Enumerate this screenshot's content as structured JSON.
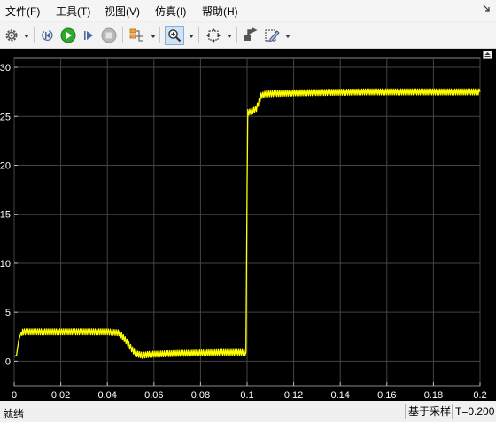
{
  "menu": [
    {
      "label": "文件(F)"
    },
    {
      "label": "工具(T)"
    },
    {
      "label": "视图(V)"
    },
    {
      "label": "仿真(I)"
    },
    {
      "label": "帮助(H)"
    }
  ],
  "toolbar": [
    {
      "icon": "gear-icon",
      "dropdown": true
    },
    {
      "icon": "step-back-icon"
    },
    {
      "icon": "run-icon",
      "color": "#2fa82f"
    },
    {
      "icon": "step-forward-icon"
    },
    {
      "icon": "stop-icon",
      "disabled": true
    },
    {
      "icon": "signal-select-icon",
      "dropdown": true
    },
    {
      "icon": "zoom-in-icon",
      "pressed": true,
      "dropdown": true
    },
    {
      "icon": "fit-to-view-icon",
      "dropdown": true
    },
    {
      "icon": "highlight-block-icon"
    },
    {
      "icon": "edit-style-icon",
      "dropdown": true
    }
  ],
  "chart_data": {
    "type": "line",
    "title": "",
    "xlabel": "",
    "ylabel": "",
    "xlim": [
      0,
      0.2
    ],
    "ylim": [
      -2.5,
      31
    ],
    "xticks": [
      0,
      0.02,
      0.04,
      0.06,
      0.08,
      0.1,
      0.12,
      0.14,
      0.16,
      0.18,
      0.2
    ],
    "xtick_labels": [
      "0",
      "0.02",
      "0.04",
      "0.06",
      "0.08",
      "0.1",
      "0.12",
      "0.14",
      "0.16",
      "0.18",
      "0.2"
    ],
    "yticks": [
      0,
      5,
      10,
      15,
      20,
      25,
      30
    ],
    "ytick_labels": [
      "0",
      "5",
      "10",
      "15",
      "20",
      "25",
      "30"
    ],
    "grid": true,
    "background": "#000000",
    "grid_color": "#444444",
    "series": [
      {
        "color": "#ffff00",
        "x": [
          0,
          0.001,
          0.002,
          0.003,
          0.004,
          0.02,
          0.04,
          0.045,
          0.048,
          0.05,
          0.052,
          0.055,
          0.058,
          0.07,
          0.09,
          0.0995,
          0.1,
          0.1003,
          0.102,
          0.104,
          0.106,
          0.108,
          0.12,
          0.15,
          0.18,
          0.2
        ],
        "y": [
          0.5,
          0.6,
          2.2,
          2.9,
          3.0,
          3.0,
          3.0,
          2.9,
          2.1,
          1.4,
          0.8,
          0.6,
          0.7,
          0.8,
          0.9,
          0.9,
          18,
          25.4,
          25.5,
          25.8,
          27.1,
          27.3,
          27.4,
          27.5,
          27.5,
          27.5
        ],
        "ripple": 0.3
      }
    ]
  },
  "status": {
    "text": "就绪",
    "sample_mode": "基于采样",
    "time": "T=0.200"
  }
}
